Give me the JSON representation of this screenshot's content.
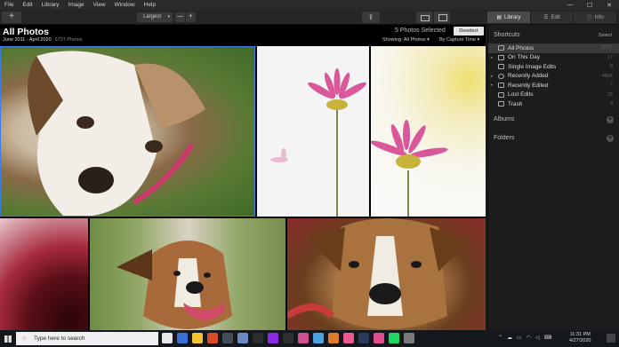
{
  "menu": [
    "File",
    "Edit",
    "Library",
    "Image",
    "View",
    "Window",
    "Help"
  ],
  "window_controls": [
    "—",
    "☐",
    "✕"
  ],
  "toolbar": {
    "add_label": "+",
    "zoom_value": "Largest",
    "zoom_minus": "—",
    "zoom_plus": "+",
    "share_icon": "share-icon",
    "tabs": [
      {
        "label": "Library",
        "active": true
      },
      {
        "label": "Edit",
        "active": false
      },
      {
        "label": "Info",
        "active": false
      }
    ]
  },
  "header": {
    "title": "All Photos",
    "date_range": "June 2011 - April 2020",
    "photo_count": "5737 Photos",
    "selected_text": "5 Photos Selected",
    "deselect_label": "Deselect",
    "showing_label": "Showing:",
    "showing_value": "All Photos",
    "sort_value": "By Capture Time"
  },
  "photos": [
    {
      "subject": "dog close-up",
      "selected": true
    },
    {
      "subject": "pink daisy stem"
    },
    {
      "subject": "pink daisy yellow background"
    },
    {
      "subject": "red flower macro"
    },
    {
      "subject": "dog smiling on path"
    },
    {
      "subject": "dog portrait"
    }
  ],
  "sidebar": {
    "shortcuts_heading": "Shortcuts",
    "select_label": "Select",
    "items": [
      {
        "label": "All Photos",
        "count": "5737",
        "active": true
      },
      {
        "label": "On This Day",
        "count": "17"
      },
      {
        "label": "Single Image Edits",
        "count": "8"
      },
      {
        "label": "Recently Added",
        "count": "4804"
      },
      {
        "label": "Recently Edited",
        "count": "7"
      },
      {
        "label": "Lost Edits",
        "count": "25"
      },
      {
        "label": "Trash",
        "count": "4"
      }
    ],
    "albums_heading": "Albums",
    "folders_heading": "Folders"
  },
  "taskbar": {
    "search_placeholder": "Type here to search",
    "time": "11:31 PM",
    "date": "4/27/2020",
    "app_colors": [
      "#e8e8e8",
      "#3a6fd8",
      "#f2c233",
      "#d94b2b",
      "#444c58",
      "#6a88c2",
      "#2c2c2c",
      "#8a2be2",
      "#2f2f2f",
      "#d24f8e",
      "#4aa3df",
      "#e07b2b",
      "#eb5a8c",
      "#2c3a5a",
      "#e04e8e",
      "#1ed760",
      "#7a7a7a"
    ]
  }
}
